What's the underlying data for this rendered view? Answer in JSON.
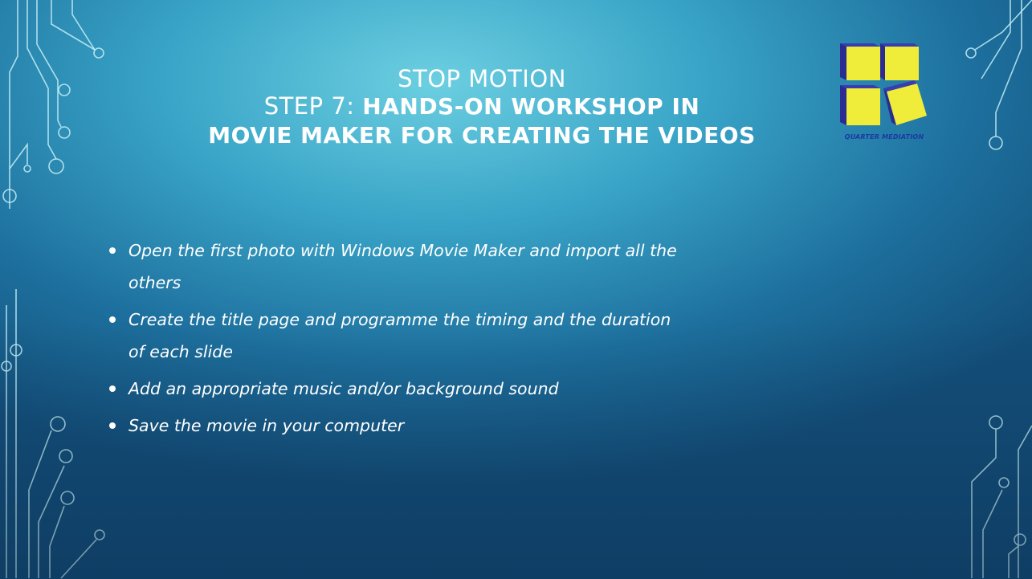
{
  "slide": {
    "title_line1": "STOP MOTION",
    "title_prefix": "STEP 7: ",
    "title_bold": "HANDS-ON WORKSHOP IN",
    "title_line3": "MOVIE MAKER FOR CREATING THE VIDEOS"
  },
  "logo": {
    "caption": "QUARTER MEDIATION",
    "colors": {
      "block": "#efec3a",
      "edge": "#2b2c91"
    }
  },
  "bullets": [
    {
      "text": "Open the first photo with Windows Movie Maker and import all the others"
    },
    {
      "text": "Create the title page and programme the timing and the duration of each slide"
    },
    {
      "text": "Add an appropriate music and/or background sound"
    },
    {
      "text": "Save the movie in your computer"
    }
  ],
  "colors": {
    "background_light": "#6ccfe1",
    "background_dark": "#134f7a",
    "text": "#ffffff",
    "circuit_lines": "#b9ecf4"
  }
}
